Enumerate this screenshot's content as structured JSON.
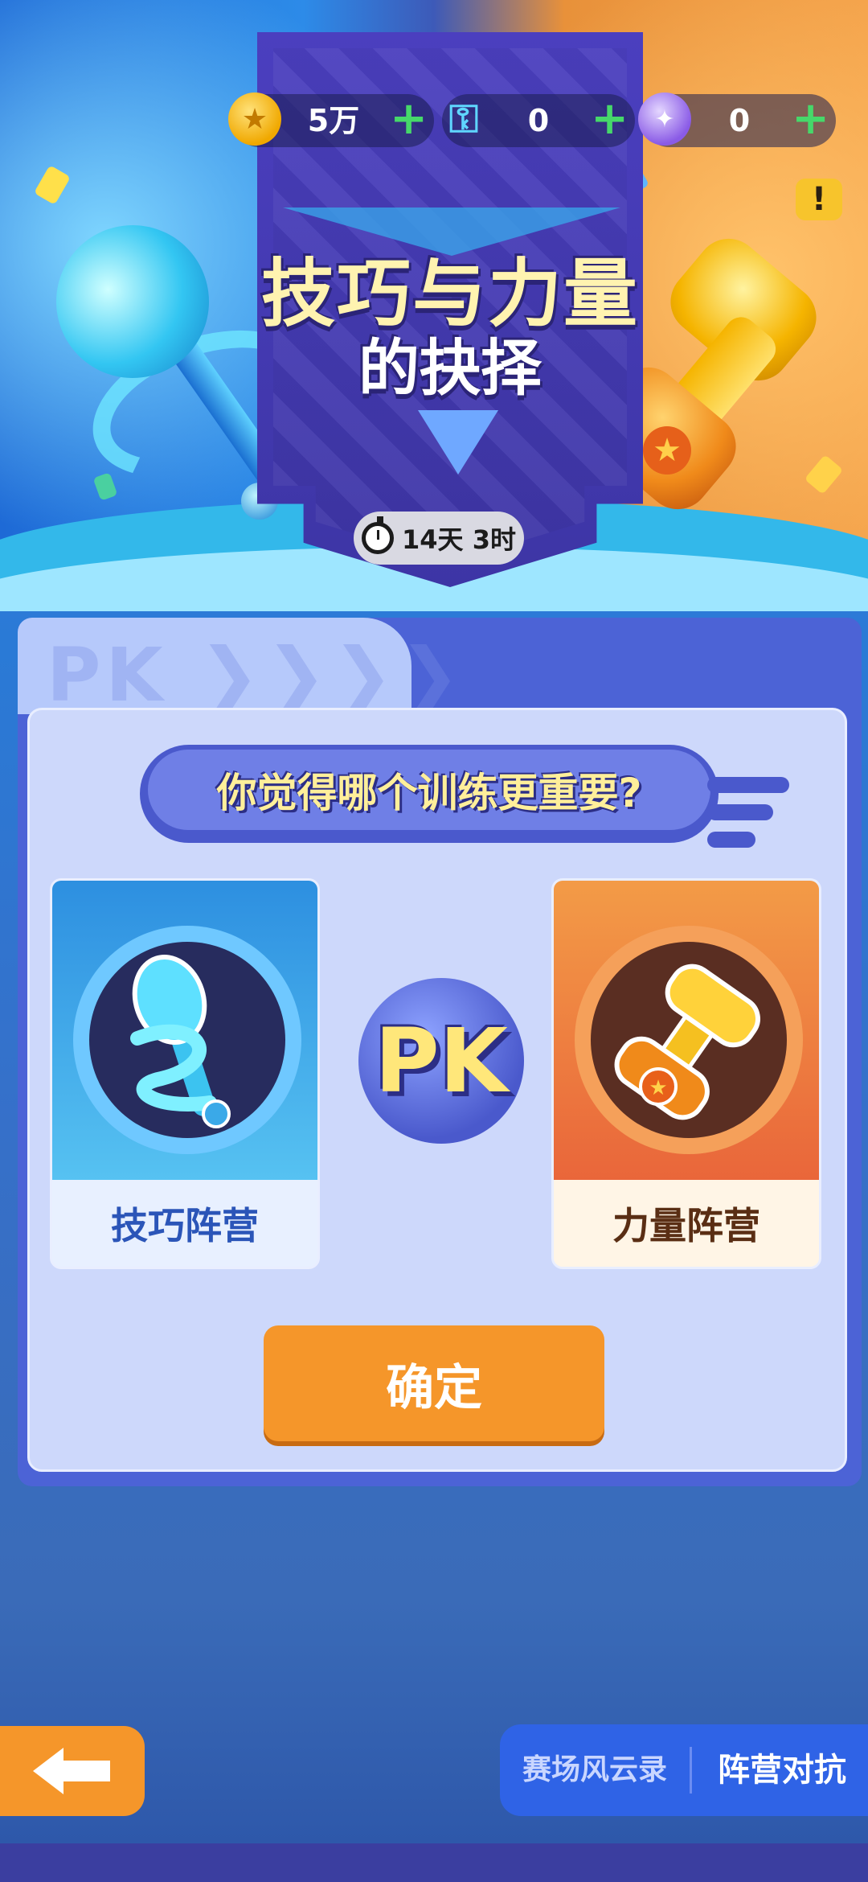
{
  "currencies": [
    {
      "icon": "gold-coin-icon",
      "value": "5万",
      "plus": "+"
    },
    {
      "icon": "key-icon",
      "value": "0",
      "plus": "+"
    },
    {
      "icon": "purple-token-icon",
      "value": "0",
      "plus": "+"
    }
  ],
  "banner": {
    "title_line1": "技巧与力量",
    "title_line2": "的抉择",
    "timer": "14天 3时"
  },
  "panel": {
    "watermark": "PK ❯❯❯❯",
    "question": "你觉得哪个训练更重要?",
    "pk_label": "PK",
    "options": [
      {
        "label": "技巧阵营",
        "icon": "skill-staff-icon"
      },
      {
        "label": "力量阵营",
        "icon": "power-dumbbell-icon"
      }
    ],
    "confirm_label": "确定"
  },
  "nav": {
    "back_icon": "back-arrow-icon",
    "record_label": "赛场风云录",
    "faction_label": "阵营对抗"
  },
  "colors": {
    "accent_orange": "#f5962a",
    "panel_blue": "#4c63d6",
    "skill_blue": "#3aa7e8",
    "power_orange": "#ef8a3a"
  }
}
